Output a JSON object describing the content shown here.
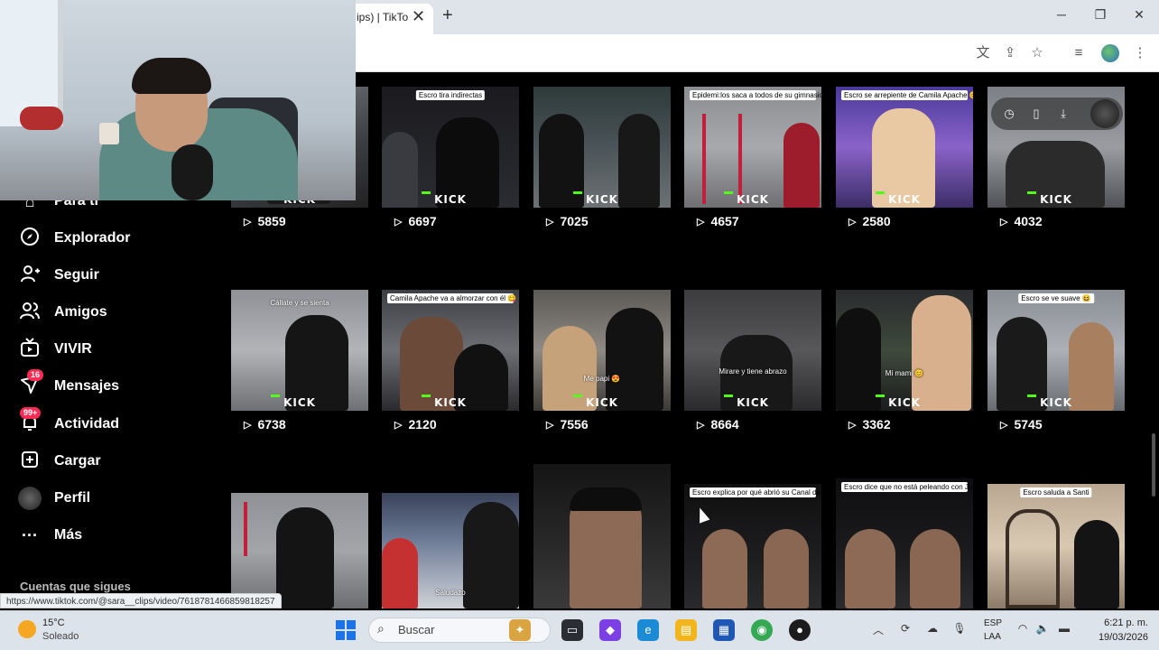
{
  "browser": {
    "tab_title": "ips) | TikTo",
    "tab_close": "✕",
    "new_tab": "+",
    "win_minimize": "─",
    "win_maximize": "❐",
    "win_close": "✕"
  },
  "sidebar": {
    "partial_item": "Para ti",
    "items": [
      {
        "label": "Explorador",
        "icon": "compass-icon"
      },
      {
        "label": "Seguir",
        "icon": "user-plus-icon"
      },
      {
        "label": "Amigos",
        "icon": "friends-icon"
      },
      {
        "label": "VIVIR",
        "icon": "live-tv-icon"
      },
      {
        "label": "Mensajes",
        "icon": "send-icon",
        "badge": "16"
      },
      {
        "label": "Actividad",
        "icon": "bell-icon",
        "badge": "99+"
      },
      {
        "label": "Cargar",
        "icon": "upload-icon"
      },
      {
        "label": "Perfil",
        "icon": "avatar"
      },
      {
        "label": "Más",
        "icon": "more-icon"
      }
    ],
    "section_following": "Cuentas que sigues"
  },
  "videos": {
    "row1": [
      {
        "views": "5859",
        "caption": ""
      },
      {
        "views": "6697",
        "caption": "Escro tira indirectas"
      },
      {
        "views": "7025",
        "caption": ""
      },
      {
        "views": "4657",
        "caption": "Epidemi:los saca a todos de su gimnasio"
      },
      {
        "views": "2580",
        "caption": "Escro se arrepiente de Camila Apache 😊"
      },
      {
        "views": "4032",
        "caption": ""
      }
    ],
    "row2": [
      {
        "views": "6738",
        "caption": "",
        "inline": "Cállate y se sienta"
      },
      {
        "views": "2120",
        "caption": "Camila Apache va a almorzar con él 😋",
        "inline": ""
      },
      {
        "views": "7556",
        "caption": "",
        "inline": "Me papi 😍"
      },
      {
        "views": "8664",
        "caption": "",
        "inline": "Mirare y tiene abrazo"
      },
      {
        "views": "3362",
        "caption": "",
        "inline": "Mi mami 😊"
      },
      {
        "views": "5745",
        "caption": "Escro se ve suave 😆",
        "inline": ""
      }
    ],
    "row3": [
      {
        "caption": "",
        "inline": ""
      },
      {
        "caption": "",
        "inline": "Saludazo"
      },
      {
        "caption": "",
        "inline": ""
      },
      {
        "caption": "Escro explica por qué abrió su Canal de Kick",
        "inline": ""
      },
      {
        "caption": "Escro dice que no está peleando con Juanfer",
        "inline": ""
      },
      {
        "caption": "Escro saluda a Santi",
        "inline": ""
      }
    ],
    "kick_label": "KICK"
  },
  "status_url": "https://www.tiktok.com/@sara__clips/video/7618781466859818257",
  "taskbar": {
    "temperature": "15°C",
    "weather": "Soleado",
    "search_placeholder": "Buscar",
    "lang_line1": "ESP",
    "lang_line2": "LAA",
    "time": "6:21 p. m.",
    "date": "19/03/2026"
  }
}
